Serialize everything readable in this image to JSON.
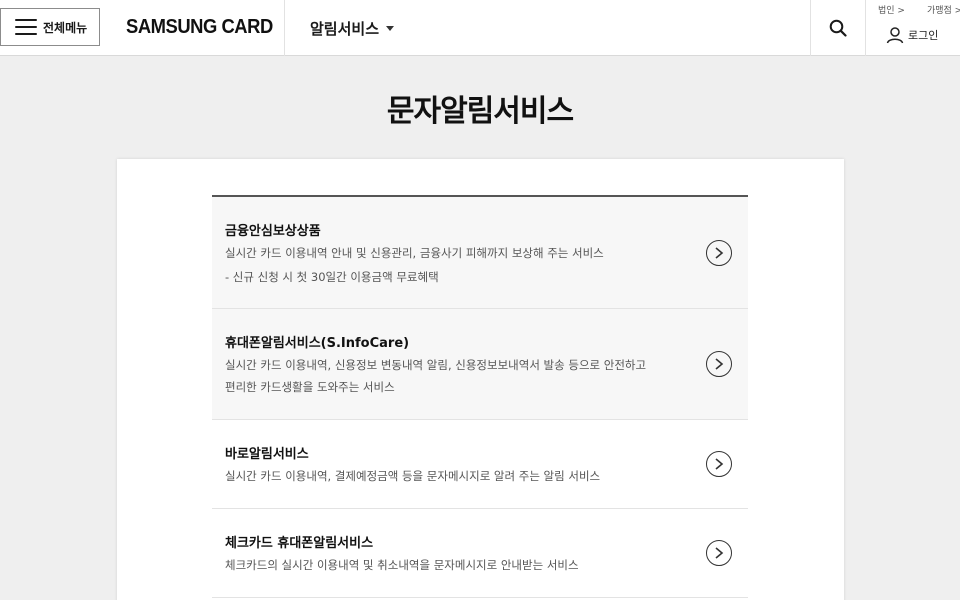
{
  "header": {
    "menu_label": "전체메뉴",
    "logo_text": "SAMSUNG CARD",
    "service_nav_label": "알림서비스",
    "util_links": [
      "법인 >",
      "가맹점 >"
    ],
    "login_label": "로그인",
    "search_icon": "search-icon",
    "user_icon": "user-icon"
  },
  "page": {
    "title": "문자알림서비스"
  },
  "services": [
    {
      "title": "금융안심보상상품",
      "desc": [
        "실시간 카드 이용내역 안내 및 신용관리, 금융사기 피해까지 보상해 주는 서비스",
        "- 신규 신청 시 첫 30일간 이용금액 무료혜택"
      ]
    },
    {
      "title": "휴대폰알림서비스(S.InfoCare)",
      "desc": [
        "실시간 카드 이용내역, 신용정보 변동내역 알림, 신용정보보내역서 발송 등으로 안전하고",
        "편리한 카드생활을 도와주는 서비스"
      ]
    },
    {
      "title": "바로알림서비스",
      "desc": [
        "실시간 카드 이용내역, 결제예정금액 등을 문자메시지로 알려 주는 알림 서비스"
      ]
    },
    {
      "title": "체크카드 휴대폰알림서비스",
      "desc": [
        "체크카드의 실시간 이용내역 및 취소내역을 문자메시지로 안내받는 서비스"
      ]
    }
  ],
  "colors": {
    "background": "#efefef",
    "card": "#ffffff",
    "shaded_row": "#f7f7f7",
    "text": "#111111"
  }
}
